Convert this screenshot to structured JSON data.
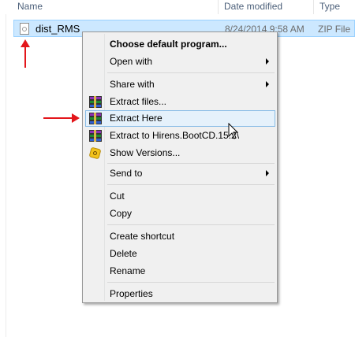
{
  "columns": {
    "name": "Name",
    "date": "Date modified",
    "type": "Type"
  },
  "file": {
    "name": "dist_RMS",
    "date_modified": "8/24/2014 9:58 AM",
    "type": "ZIP File",
    "icon": "zip-file-icon"
  },
  "menu": {
    "choose_default": "Choose default program...",
    "open_with": "Open with",
    "share_with": "Share with",
    "extract_files": "Extract files...",
    "extract_here": "Extract Here",
    "extract_to": "Extract to Hirens.BootCD.15.2\\",
    "show_versions": "Show Versions...",
    "send_to": "Send to",
    "cut": "Cut",
    "copy": "Copy",
    "create_shortcut": "Create shortcut",
    "delete": "Delete",
    "rename": "Rename",
    "properties": "Properties"
  },
  "colors": {
    "selection": "#cce8ff",
    "highlight": "#e5f1fb",
    "arrow": "#e3161b"
  }
}
